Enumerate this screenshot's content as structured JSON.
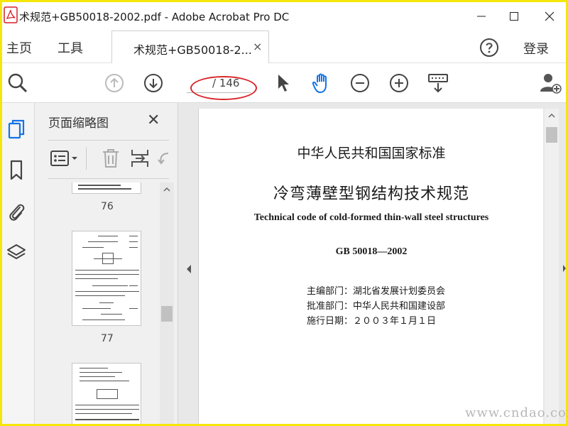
{
  "window": {
    "title": "术规范+GB50018-2002.pdf - Adobe Acrobat Pro DC"
  },
  "menubar": {
    "home_label": "主页",
    "tools_label": "工具",
    "doc_tab_label": "术规范+GB50018-2...",
    "doc_tab_close": "×",
    "login_label": "登录"
  },
  "toolbar": {
    "page_current": "",
    "page_total": "/ 146"
  },
  "thumbnail_panel": {
    "title": "页面缩略图",
    "close": "✕",
    "pages": [
      {
        "label": "76"
      },
      {
        "label": "77"
      }
    ]
  },
  "document": {
    "standard_heading": "中华人民共和国国家标准",
    "title_cn": "冷弯薄壁型钢结构技术规范",
    "title_en": "Technical code of cold-formed thin-wall steel structures",
    "code": "GB 50018—2002",
    "meta": [
      "主编部门：湖北省发展计划委员会",
      "批准部门：中华人民共和国建设部",
      "施行日期：２００３年１月１日"
    ]
  },
  "watermark": "www.cndao.com",
  "colors": {
    "hand_tool_active": "#1473e6",
    "annotation_ellipse": "#d9262c",
    "frame": "#f5e60a"
  }
}
